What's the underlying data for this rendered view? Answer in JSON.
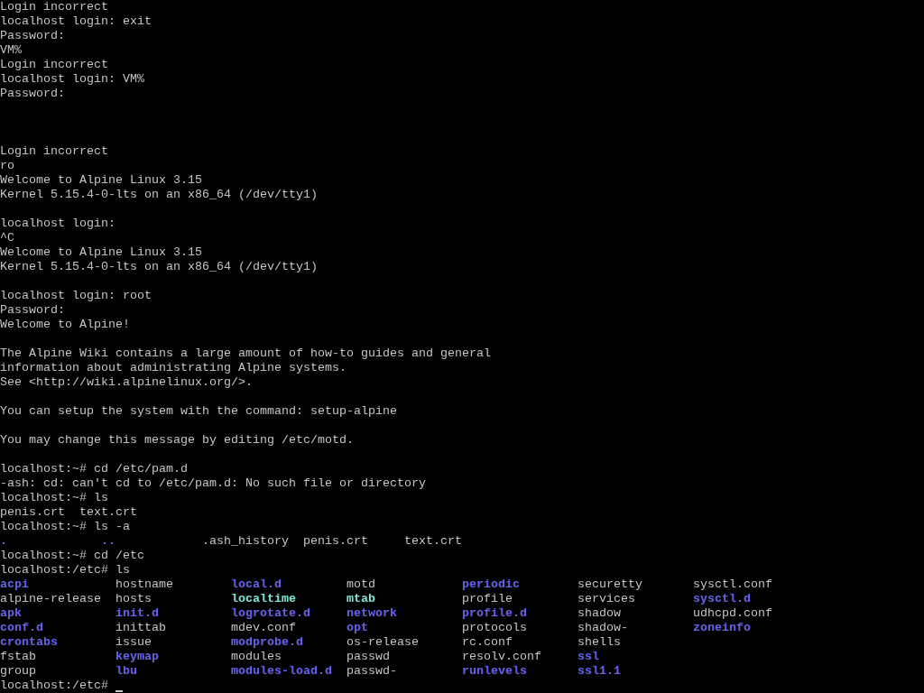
{
  "console": {
    "cursor": true,
    "lines": [
      {
        "kind": "text",
        "text": "Login incorrect"
      },
      {
        "kind": "text",
        "text": "localhost login: exit"
      },
      {
        "kind": "text",
        "text": "Password:"
      },
      {
        "kind": "text",
        "text": "VM%"
      },
      {
        "kind": "text",
        "text": "Login incorrect"
      },
      {
        "kind": "text",
        "text": "localhost login: VM%"
      },
      {
        "kind": "text",
        "text": "Password:"
      },
      {
        "kind": "blank"
      },
      {
        "kind": "blank"
      },
      {
        "kind": "blank"
      },
      {
        "kind": "text",
        "text": "Login incorrect"
      },
      {
        "kind": "text",
        "text": "ro"
      },
      {
        "kind": "text",
        "text": "Welcome to Alpine Linux 3.15"
      },
      {
        "kind": "text",
        "text": "Kernel 5.15.4-0-lts on an x86_64 (/dev/tty1)"
      },
      {
        "kind": "blank"
      },
      {
        "kind": "text",
        "text": "localhost login:"
      },
      {
        "kind": "text",
        "text": "^C"
      },
      {
        "kind": "text",
        "text": "Welcome to Alpine Linux 3.15"
      },
      {
        "kind": "text",
        "text": "Kernel 5.15.4-0-lts on an x86_64 (/dev/tty1)"
      },
      {
        "kind": "blank"
      },
      {
        "kind": "text",
        "text": "localhost login: root"
      },
      {
        "kind": "text",
        "text": "Password:"
      },
      {
        "kind": "text",
        "text": "Welcome to Alpine!"
      },
      {
        "kind": "blank"
      },
      {
        "kind": "text",
        "text": "The Alpine Wiki contains a large amount of how-to guides and general"
      },
      {
        "kind": "text",
        "text": "information about administrating Alpine systems."
      },
      {
        "kind": "text",
        "text": "See <http://wiki.alpinelinux.org/>."
      },
      {
        "kind": "blank"
      },
      {
        "kind": "text",
        "text": "You can setup the system with the command: setup-alpine"
      },
      {
        "kind": "blank"
      },
      {
        "kind": "text",
        "text": "You may change this message by editing /etc/motd."
      },
      {
        "kind": "blank"
      },
      {
        "kind": "text",
        "text": "localhost:~# cd /etc/pam.d"
      },
      {
        "kind": "text",
        "text": "-ash: cd: can't cd to /etc/pam.d: No such file or directory"
      },
      {
        "kind": "text",
        "text": "localhost:~# ls"
      },
      {
        "kind": "listing",
        "rows": [
          [
            {
              "name": "penis.crt",
              "kind": "file"
            },
            {
              "name": "text.crt",
              "kind": "file"
            }
          ]
        ]
      },
      {
        "kind": "text",
        "text": "localhost:~# ls -a"
      },
      {
        "kind": "listing",
        "rows": [
          [
            {
              "name": ".",
              "kind": "dir"
            },
            {
              "name": "..",
              "kind": "dir"
            },
            {
              "name": ".ash_history",
              "kind": "file"
            },
            {
              "name": "penis.crt",
              "kind": "file"
            },
            {
              "name": "text.crt",
              "kind": "file"
            }
          ]
        ]
      },
      {
        "kind": "text",
        "text": "localhost:~# cd /etc"
      },
      {
        "kind": "text",
        "text": "localhost:/etc# ls"
      },
      {
        "kind": "listing",
        "rows": [
          [
            {
              "name": "acpi",
              "kind": "dir"
            },
            {
              "name": "hostname",
              "kind": "file"
            },
            {
              "name": "local.d",
              "kind": "dir"
            },
            {
              "name": "motd",
              "kind": "file"
            },
            {
              "name": "periodic",
              "kind": "dir"
            },
            {
              "name": "securetty",
              "kind": "file"
            },
            {
              "name": "sysctl.conf",
              "kind": "file"
            }
          ],
          [
            {
              "name": "alpine-release",
              "kind": "file"
            },
            {
              "name": "hosts",
              "kind": "file"
            },
            {
              "name": "localtime",
              "kind": "link"
            },
            {
              "name": "mtab",
              "kind": "link"
            },
            {
              "name": "profile",
              "kind": "file"
            },
            {
              "name": "services",
              "kind": "file"
            },
            {
              "name": "sysctl.d",
              "kind": "dir"
            }
          ],
          [
            {
              "name": "apk",
              "kind": "dir"
            },
            {
              "name": "init.d",
              "kind": "dir"
            },
            {
              "name": "logrotate.d",
              "kind": "dir"
            },
            {
              "name": "network",
              "kind": "dir"
            },
            {
              "name": "profile.d",
              "kind": "dir"
            },
            {
              "name": "shadow",
              "kind": "file"
            },
            {
              "name": "udhcpd.conf",
              "kind": "file"
            }
          ],
          [
            {
              "name": "conf.d",
              "kind": "dir"
            },
            {
              "name": "inittab",
              "kind": "file"
            },
            {
              "name": "mdev.conf",
              "kind": "file"
            },
            {
              "name": "opt",
              "kind": "dir"
            },
            {
              "name": "protocols",
              "kind": "file"
            },
            {
              "name": "shadow-",
              "kind": "file"
            },
            {
              "name": "zoneinfo",
              "kind": "dir"
            }
          ],
          [
            {
              "name": "crontabs",
              "kind": "dir"
            },
            {
              "name": "issue",
              "kind": "file"
            },
            {
              "name": "modprobe.d",
              "kind": "dir"
            },
            {
              "name": "os-release",
              "kind": "file"
            },
            {
              "name": "rc.conf",
              "kind": "file"
            },
            {
              "name": "shells",
              "kind": "file"
            }
          ],
          [
            {
              "name": "fstab",
              "kind": "file"
            },
            {
              "name": "keymap",
              "kind": "dir"
            },
            {
              "name": "modules",
              "kind": "file"
            },
            {
              "name": "passwd",
              "kind": "file"
            },
            {
              "name": "resolv.conf",
              "kind": "file"
            },
            {
              "name": "ssl",
              "kind": "dir"
            }
          ],
          [
            {
              "name": "group",
              "kind": "file"
            },
            {
              "name": "lbu",
              "kind": "dir"
            },
            {
              "name": "modules-load.d",
              "kind": "dir"
            },
            {
              "name": "passwd-",
              "kind": "file"
            },
            {
              "name": "runlevels",
              "kind": "dir"
            },
            {
              "name": "ssl1.1",
              "kind": "dir"
            }
          ]
        ]
      },
      {
        "kind": "text",
        "text": "localhost:/etc#"
      }
    ]
  }
}
